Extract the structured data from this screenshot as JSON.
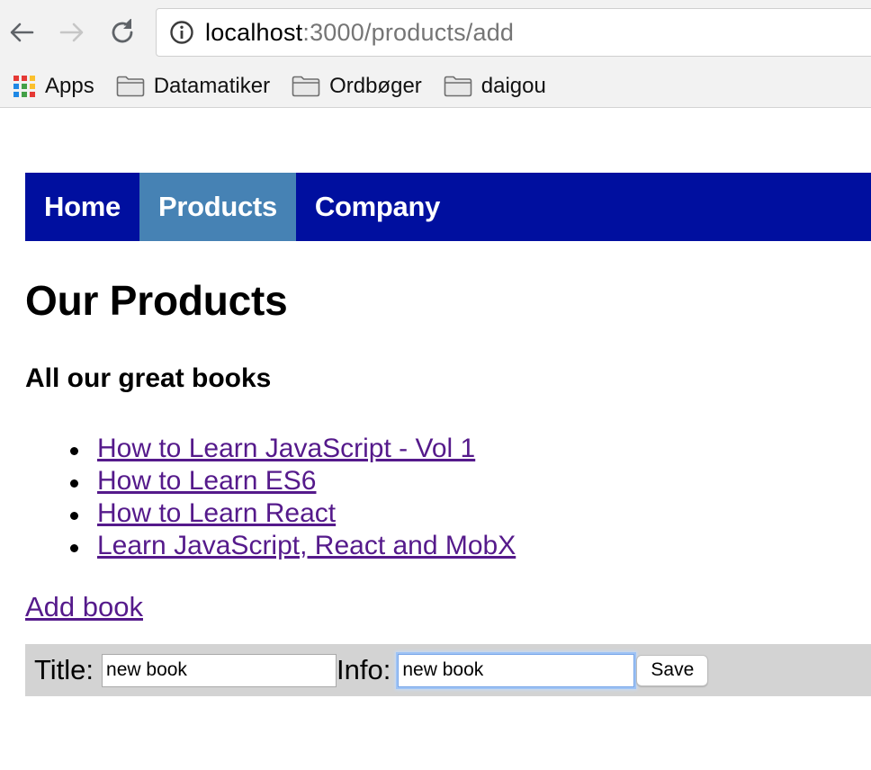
{
  "browser": {
    "url_host": "localhost",
    "url_rest": ":3000/products/add",
    "bookmarks": [
      {
        "label": "Apps",
        "icon": "apps-grid-icon"
      },
      {
        "label": "Datamatiker",
        "icon": "folder-icon"
      },
      {
        "label": "Ordbøger",
        "icon": "folder-icon"
      },
      {
        "label": "daigou",
        "icon": "folder-icon"
      }
    ]
  },
  "nav": {
    "items": [
      {
        "label": "Home",
        "active": false
      },
      {
        "label": "Products",
        "active": true
      },
      {
        "label": "Company",
        "active": false
      }
    ],
    "bg_color": "#000f9f",
    "active_color": "#4682b4"
  },
  "page": {
    "title": "Our Products",
    "subtitle": "All our great books",
    "books": [
      "How to Learn JavaScript - Vol 1",
      "How to Learn ES6",
      "How to Learn React",
      "Learn JavaScript, React and MobX"
    ],
    "add_link": "Add book"
  },
  "form": {
    "title_label": "Title:",
    "title_value": "new book",
    "info_label": "Info:",
    "info_value": "new book",
    "save_label": "Save"
  }
}
